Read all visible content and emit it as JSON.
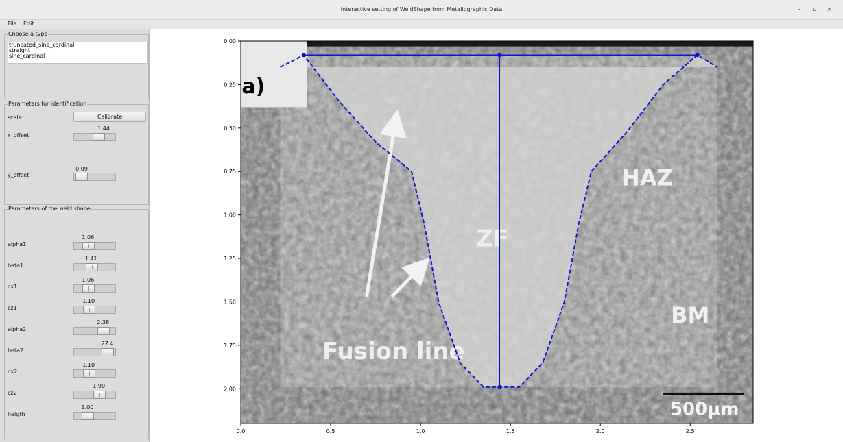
{
  "window": {
    "title": "Interactive setting of WeldShape from Metallographic Data",
    "minimize": "-",
    "maximize": "▫",
    "close": "×"
  },
  "menu": {
    "file": "File",
    "edit": "Edit"
  },
  "type_group": {
    "title": "Choose a type",
    "options": [
      "truncated_sine_cardinal",
      "straight",
      "sine_cardinal"
    ]
  },
  "ident_group": {
    "title": "Parameters for identification",
    "scale_label": "scale",
    "calibrate_label": "Calibrate",
    "x_offset": {
      "label": "x_offset",
      "value": "1.44",
      "position": 0.62
    },
    "y_offset": {
      "label": "y_offset",
      "value": "0.09",
      "position": 0.04
    }
  },
  "shape_group": {
    "title": "Parameters of the weld shape",
    "params": [
      {
        "label": "alpha1",
        "value": "1.06",
        "position": 0.28
      },
      {
        "label": "beta1",
        "value": "1.41",
        "position": 0.38
      },
      {
        "label": "cx1",
        "value": "1.06",
        "position": 0.28
      },
      {
        "label": "cz1",
        "value": "1.10",
        "position": 0.3
      },
      {
        "label": "alpha2",
        "value": "2.38",
        "position": 0.78
      },
      {
        "label": "beta2",
        "value": "27.4",
        "position": 0.92
      },
      {
        "label": "cx2",
        "value": "1.10",
        "position": 0.3
      },
      {
        "label": "cz2",
        "value": "1.90",
        "position": 0.64
      },
      {
        "label": "heigth",
        "value": "1.00",
        "position": 0.26
      }
    ]
  },
  "chart_data": {
    "type": "line",
    "xlim": [
      0,
      2.85
    ],
    "ylim": [
      2.2,
      0
    ],
    "xticks": [
      "0.0",
      "0.5",
      "1.0",
      "1.5",
      "2.0",
      "2.5"
    ],
    "xtick_values": [
      0,
      0.5,
      1.0,
      1.5,
      2.0,
      2.5
    ],
    "yticks": [
      "0.00",
      "0.25",
      "0.50",
      "0.75",
      "1.00",
      "1.25",
      "1.50",
      "1.75",
      "2.00"
    ],
    "ytick_values": [
      0,
      0.25,
      0.5,
      0.75,
      1.0,
      1.25,
      1.5,
      1.75,
      2.0
    ],
    "annotations": {
      "panel": "a)",
      "fz": "ZF",
      "haz": "HAZ",
      "bm": "BM",
      "fusion": "Fusion line",
      "scalebar": "500µm"
    },
    "colors": {
      "weld_line": "#0a14d2",
      "photo_dark": "#6e6e6e",
      "photo_light": "#c4c4c4"
    },
    "weld_profile": {
      "x": [
        0.22,
        0.35,
        0.55,
        0.75,
        0.95,
        1.02,
        1.1,
        1.22,
        1.35,
        1.44,
        1.55,
        1.68,
        1.8,
        1.88,
        1.95,
        2.15,
        2.35,
        2.54,
        2.65
      ],
      "y": [
        0.15,
        0.08,
        0.35,
        0.58,
        0.75,
        1.05,
        1.5,
        1.85,
        1.99,
        1.99,
        1.99,
        1.85,
        1.5,
        1.05,
        0.75,
        0.52,
        0.25,
        0.08,
        0.15
      ]
    },
    "control_points": {
      "x": [
        0.35,
        1.44,
        2.54,
        1.44
      ],
      "y": [
        0.08,
        0.08,
        0.08,
        1.99
      ]
    },
    "centerline": {
      "x": [
        1.44,
        1.44
      ],
      "y": [
        0.08,
        1.99
      ]
    },
    "topline": {
      "x": [
        0.35,
        2.54
      ],
      "y": [
        0.08,
        0.08
      ]
    }
  }
}
